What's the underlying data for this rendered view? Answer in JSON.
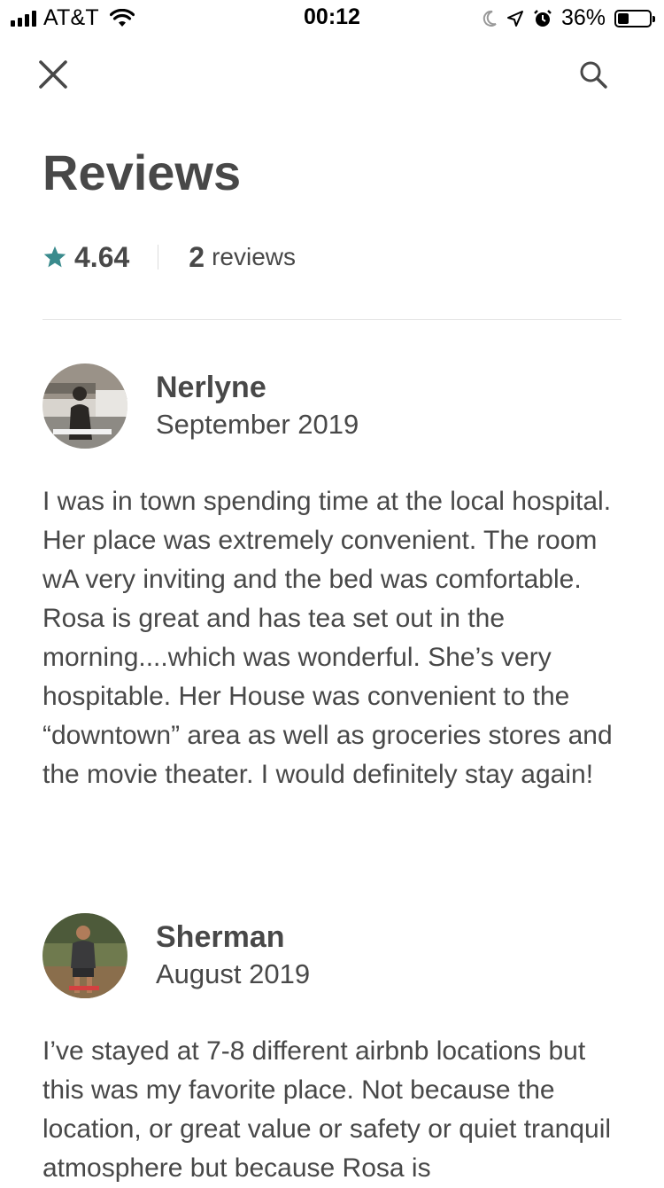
{
  "status_bar": {
    "carrier": "AT&T",
    "time": "00:12",
    "battery_percent": "36%",
    "battery_level": 0.36,
    "icons": [
      "signal-icon",
      "wifi-icon",
      "moon-icon",
      "location-arrow-icon",
      "alarm-icon",
      "battery-icon"
    ]
  },
  "nav": {
    "close_icon": "close-icon",
    "search_icon": "search-icon"
  },
  "page": {
    "title": "Reviews"
  },
  "summary": {
    "rating": "4.64",
    "review_count": "2",
    "review_label": "reviews",
    "star_color": "#3a8b8d"
  },
  "reviews": [
    {
      "name": "Nerlyne",
      "date": "September 2019",
      "text": "I was in town spending time at the local hospital. Her place was extremely convenient. The room wA very inviting and the bed was comfortable. Rosa is great and has tea set out in the morning....which was wonderful. She’s very hospitable. Her House was convenient to the “downtown” area as well as groceries stores and the movie theater. I would definitely stay again!"
    },
    {
      "name": "Sherman",
      "date": "August 2019",
      "text": "I’ve stayed at 7-8 different airbnb locations but this was my favorite place.  Not because the location, or great value or safety or quiet tranquil atmosphere but because Rosa is"
    }
  ]
}
